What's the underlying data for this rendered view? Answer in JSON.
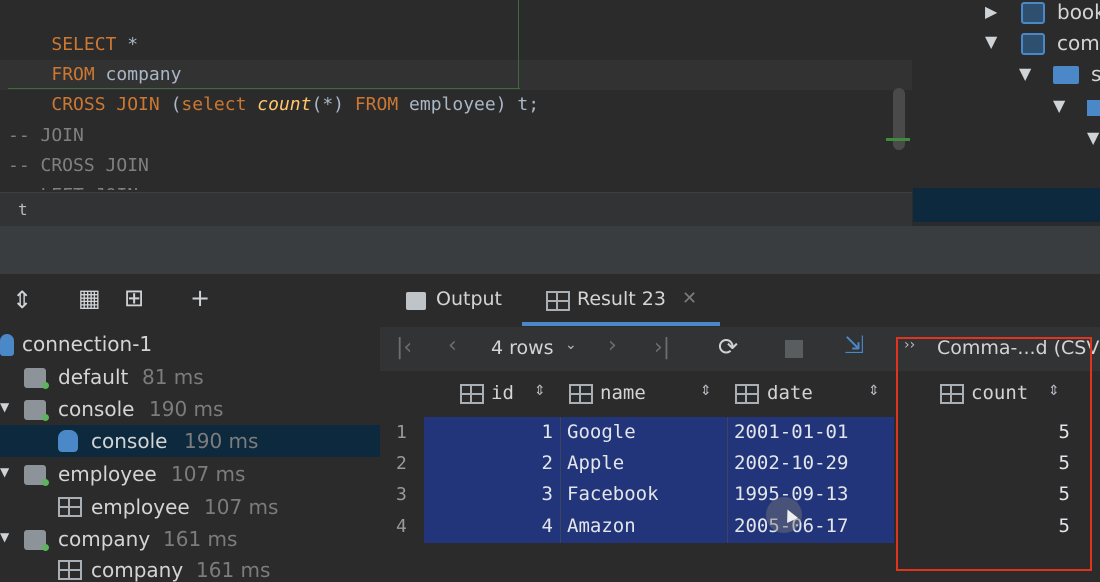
{
  "editor": {
    "line1": {
      "kw": "SELECT",
      "rest": " *"
    },
    "line2": {
      "kw": "FROM",
      "rest": " company"
    },
    "line3": {
      "kw1": "CROSS JOIN",
      "p1": " (",
      "kw2": "select",
      "fn": " count",
      "args": "(*)",
      "kw3": " FROM",
      "tbl": " employee",
      "p2": ")",
      "alias": " t;"
    },
    "comment1": "-- JOIN",
    "comment2": "-- CROSS JOIN",
    "comment3": "-- LEFT JOIN"
  },
  "breadcrumb": "t",
  "right_tree": {
    "items": [
      "book",
      "com",
      "s"
    ]
  },
  "services": {
    "items": [
      {
        "name": "connection-1",
        "time": ""
      },
      {
        "name": "default",
        "time": "81 ms"
      },
      {
        "name": "console",
        "time": "190 ms"
      },
      {
        "name": "console",
        "time": "190 ms"
      },
      {
        "name": "employee",
        "time": "107 ms"
      },
      {
        "name": "employee",
        "time": "107 ms"
      },
      {
        "name": "company",
        "time": "161 ms"
      },
      {
        "name": "company",
        "time": "161 ms"
      }
    ]
  },
  "tabs": {
    "output": "Output",
    "result": "Result 23"
  },
  "result_toolbar": {
    "rows_label": "4 rows",
    "export_label": "Comma-...d (CSV"
  },
  "grid": {
    "columns": [
      "id",
      "name",
      "date",
      "count"
    ],
    "rows": [
      {
        "num": "1",
        "id": "1",
        "name": "Google",
        "date": "2001-01-01",
        "count": "5"
      },
      {
        "num": "2",
        "id": "2",
        "name": "Apple",
        "date": "2002-10-29",
        "count": "5"
      },
      {
        "num": "3",
        "id": "3",
        "name": "Facebook",
        "date": "1995-09-13",
        "count": "5"
      },
      {
        "num": "4",
        "id": "4",
        "name": "Amazon",
        "date": "2005-06-17",
        "count": "5"
      }
    ]
  },
  "colors": {
    "selection": "#23357a",
    "highlight": "#e0341f",
    "keyword": "#cc7832"
  }
}
